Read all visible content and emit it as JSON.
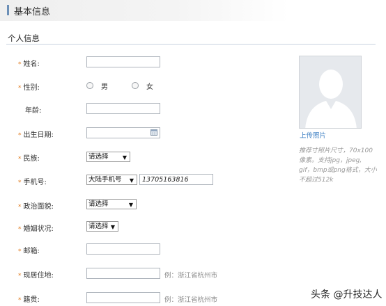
{
  "header": {
    "title": "基本信息"
  },
  "section": {
    "title": "个人信息"
  },
  "fields": {
    "name": {
      "label": "姓名:",
      "value": ""
    },
    "gender": {
      "label": "性别:",
      "options": [
        "男",
        "女"
      ]
    },
    "age": {
      "label": "年龄:",
      "value": ""
    },
    "birth_date": {
      "label": "出生日期:",
      "value": ""
    },
    "ethnicity": {
      "label": "民族:",
      "selected": "请选择"
    },
    "phone": {
      "label": "手机号:",
      "region_selected": "大陆手机号",
      "value": "13705163816"
    },
    "political_status": {
      "label": "政治面貌:",
      "selected": "请选择"
    },
    "marital_status": {
      "label": "婚姻状况:",
      "selected": "请选择"
    },
    "email": {
      "label": "邮箱:",
      "value": ""
    },
    "residence": {
      "label": "现居住地:",
      "placeholder": "",
      "example": "例：浙江省杭州市"
    },
    "hometown": {
      "label": "籍贯:",
      "placeholder": "",
      "example": "例：浙江省杭州市"
    }
  },
  "photo": {
    "upload_label": "上传照片",
    "tip": "推荐寸照片尺寸，70x100像素。支持jpg，jpeg, gif，bmp或png格式，大小不超过512k"
  },
  "watermark": "头条 @升技达人",
  "colors": {
    "required_mark": "#e07b1f",
    "link": "#3d7fc3",
    "header_bar": "#6b8fb7"
  }
}
